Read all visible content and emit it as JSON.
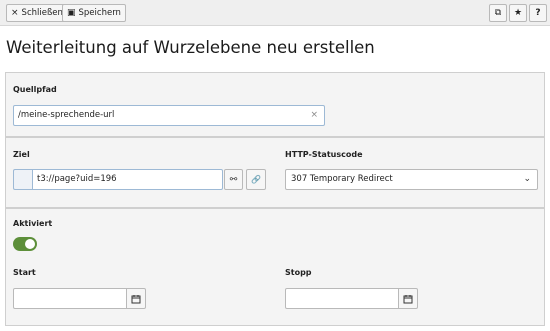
{
  "toolbar": {
    "close_label": "Schließen",
    "save_label": "Speichern",
    "close_icon": "×",
    "save_icon": "▣",
    "open_icon": "⧉",
    "star_icon": "★",
    "help_icon": "?"
  },
  "page": {
    "title": "Weiterleitung auf Wurzelebene neu erstellen"
  },
  "source": {
    "label": "Quellpfad",
    "value": "/meine-sprechende-url",
    "clear_icon": "×"
  },
  "target": {
    "label": "Ziel",
    "value": "t3://page?uid=196",
    "unlink_icon": "⚯",
    "link_icon": "🔗"
  },
  "status": {
    "label": "HTTP-Statuscode",
    "selected": "307 Temporary Redirect",
    "chevron": "⌄"
  },
  "active": {
    "label": "Aktiviert",
    "enabled": true
  },
  "start": {
    "label": "Start",
    "value": ""
  },
  "stop": {
    "label": "Stopp",
    "value": ""
  },
  "colors": {
    "toggle_on": "#5d8f3a",
    "input_focus_border": "#9db9d5"
  }
}
